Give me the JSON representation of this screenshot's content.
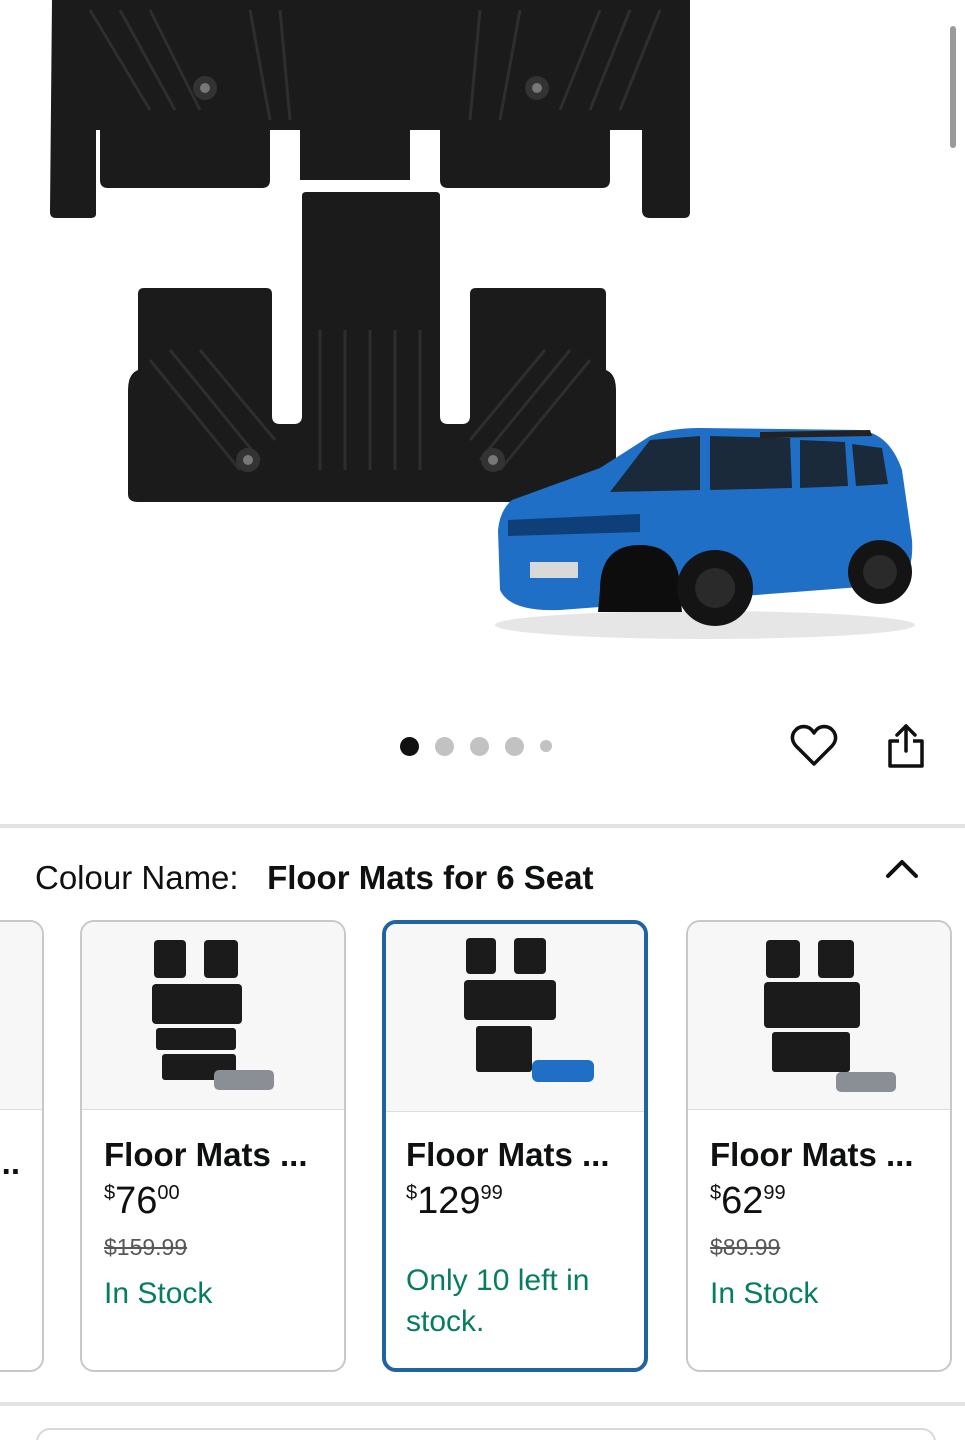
{
  "carousel": {
    "total_images": 5,
    "active_index": 0
  },
  "icons": {
    "favorite": "heart-icon",
    "share": "share-icon",
    "collapse": "chevron-up-icon"
  },
  "colour": {
    "label": "Colour Name:",
    "value": "Floor Mats for 6 Seat"
  },
  "variants": [
    {
      "title": "..",
      "partial": true
    },
    {
      "title": "Floor Mats ...",
      "currency": "$",
      "price_whole": "76",
      "price_fraction": "00",
      "was_price": "$159.99",
      "stock": "In Stock",
      "selected": false
    },
    {
      "title": "Floor Mats ...",
      "currency": "$",
      "price_whole": "129",
      "price_fraction": "99",
      "was_price": "",
      "stock": "Only 10 left in stock.",
      "selected": true
    },
    {
      "title": "Floor Mats ...",
      "currency": "$",
      "price_whole": "62",
      "price_fraction": "99",
      "was_price": "$89.99",
      "stock": "In Stock",
      "selected": false
    }
  ],
  "colors": {
    "selected_border": "#2162a1",
    "stock_green": "#067d62",
    "car_blue": "#1f6fc7"
  }
}
